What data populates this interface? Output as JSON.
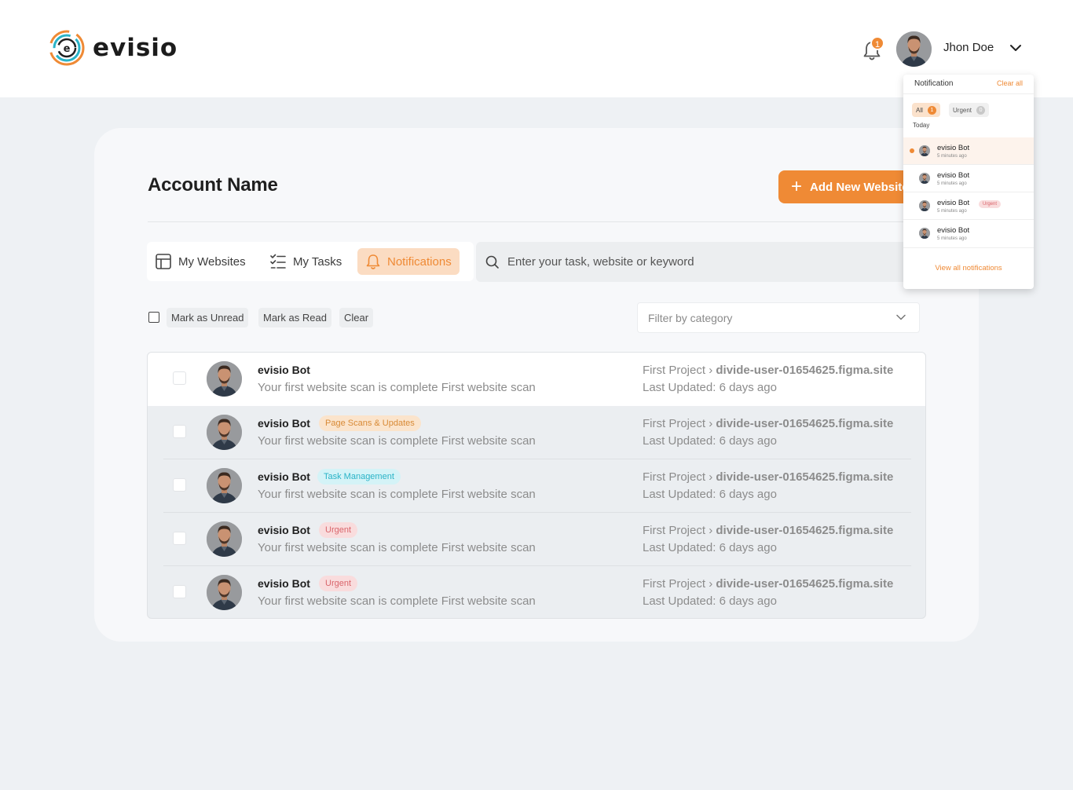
{
  "header": {
    "logo_text": "evisio",
    "notification_count": "1",
    "user_name": "Jhon Doe"
  },
  "account": {
    "title": "Account Name",
    "add_button_label": "Add New Website"
  },
  "tabs": [
    {
      "label": "My Websites",
      "icon": "layout-icon",
      "active": false
    },
    {
      "label": "My Tasks",
      "icon": "task-list-icon",
      "active": false
    },
    {
      "label": "Notifications",
      "icon": "bell-icon",
      "active": true
    }
  ],
  "search": {
    "placeholder": "Enter your task, website or keyword"
  },
  "actions": {
    "mark_unread": "Mark as Unread",
    "mark_read": "Mark as Read",
    "clear": "Clear",
    "filter_placeholder": "Filter by category"
  },
  "notifications": [
    {
      "sender": "evisio Bot",
      "tag": "",
      "message": "Your first website scan is complete First website scan",
      "project": "First Project",
      "site": "divide-user-01654625.figma.site",
      "updated": "Last Updated: 6 days ago"
    },
    {
      "sender": "evisio Bot",
      "tag": "Page Scans & Updates",
      "message": "Your first website scan is complete First website scan",
      "project": "First Project",
      "site": "divide-user-01654625.figma.site",
      "updated": "Last Updated: 6 days ago"
    },
    {
      "sender": "evisio Bot",
      "tag": "Task Management",
      "message": "Your first website scan is complete First website scan",
      "project": "First Project",
      "site": "divide-user-01654625.figma.site",
      "updated": "Last Updated: 6 days ago"
    },
    {
      "sender": "evisio Bot",
      "tag": "Urgent",
      "message": "Your first website scan is complete First website scan",
      "project": "First Project",
      "site": "divide-user-01654625.figma.site",
      "updated": "Last Updated: 6 days ago"
    },
    {
      "sender": "evisio Bot",
      "tag": "Urgent",
      "message": "Your first website scan is complete First website scan",
      "project": "First Project",
      "site": "divide-user-01654625.figma.site",
      "updated": "Last Updated: 6 days ago"
    }
  ],
  "dropdown": {
    "title": "Notification",
    "clear_all": "Clear all",
    "filter_all": "All",
    "filter_all_count": "1",
    "filter_urgent": "Urgent",
    "filter_urgent_count": "0",
    "section_today": "Today",
    "items": [
      {
        "name": "evisio Bot",
        "time": "5 minutes ago",
        "tag": "",
        "unread": true
      },
      {
        "name": "evisio Bot",
        "time": "5 minutes ago",
        "tag": "",
        "unread": false
      },
      {
        "name": "evisio Bot",
        "time": "5 minutes ago",
        "tag": "Urgent",
        "unread": false
      },
      {
        "name": "evisio Bot",
        "time": "5 minutes ago",
        "tag": "",
        "unread": false
      }
    ],
    "view_all": "View all notifications"
  },
  "colors": {
    "accent": "#ef8a35",
    "page_bg": "#eef1f4",
    "tag_orange": "#d88a36",
    "tag_cyan": "#2ab3c7",
    "tag_red": "#d9656b"
  }
}
